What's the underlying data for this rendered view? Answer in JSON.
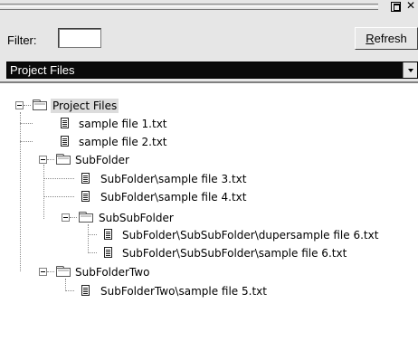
{
  "toolbar": {
    "filter_label": "Filter:",
    "filter_value": "",
    "refresh_label_accel": "R",
    "refresh_label_rest": "efresh"
  },
  "project_select": {
    "selected": "Project Files"
  },
  "tree": {
    "root": "Project Files",
    "file1": "sample file 1.txt",
    "file2": "sample file 2.txt",
    "subfolder": "SubFolder",
    "file3": "SubFolder\\sample file 3.txt",
    "file4": "SubFolder\\sample file 4.txt",
    "subsubfolder": "SubSubFolder",
    "file6a": "SubFolder\\SubSubFolder\\dupersample file 6.txt",
    "file6b": "SubFolder\\SubSubFolder\\sample file 6.txt",
    "subfoldertwo": "SubFolderTwo",
    "file5": "SubFolderTwo\\sample file 5.txt"
  },
  "icons": {
    "folder": "folder-open-icon",
    "file": "text-file-icon",
    "expander": "collapse-minus-icon"
  }
}
